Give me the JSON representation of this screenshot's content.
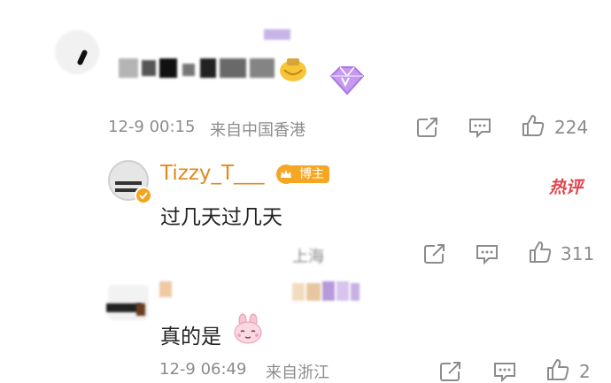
{
  "comments": [
    {
      "text": "",
      "timestamp": "12-9 00:15",
      "location": "来自中国香港",
      "likes": "224"
    },
    {
      "username": "Tizzy_T___",
      "badge": "博主",
      "text": "过几天过几天",
      "timestamp": "",
      "location": "上海",
      "likes": "311",
      "hot_tag": "热评"
    },
    {
      "text": "真的是",
      "timestamp": "12-9 06:49",
      "location": "来自浙江",
      "likes": "2"
    }
  ],
  "colors": {
    "username": "#e08a1e",
    "badge_bg": "#f5a623",
    "hot_tag": "#e0464f",
    "muted": "#8c8c8c"
  }
}
